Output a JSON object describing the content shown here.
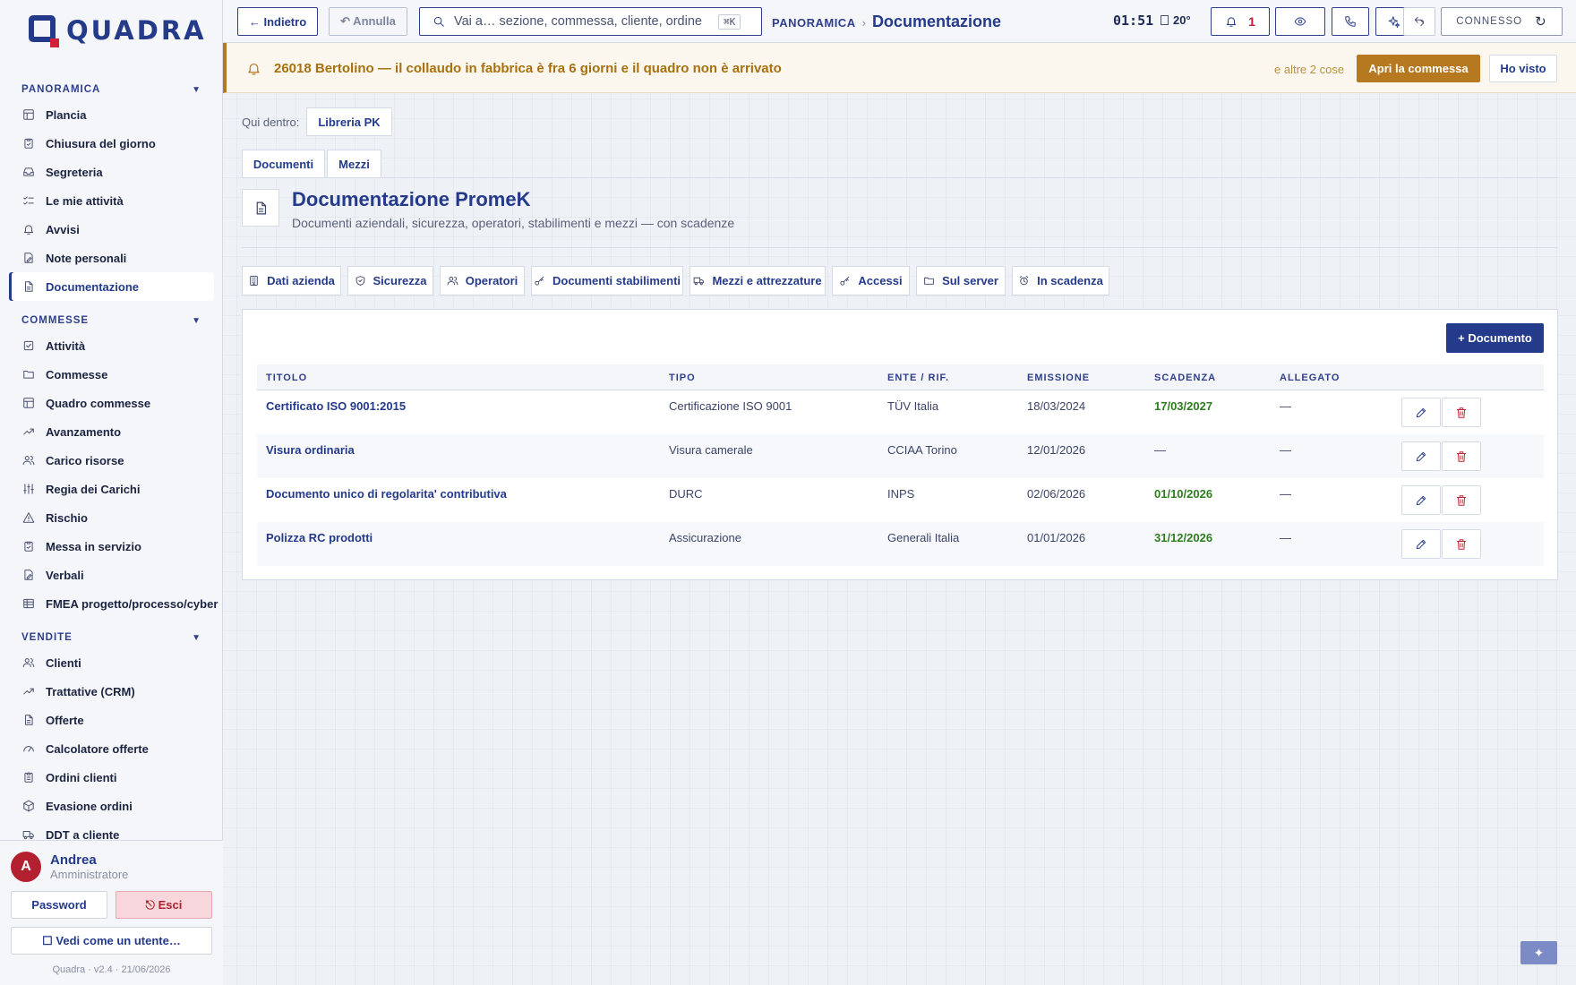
{
  "brand": {
    "name": "QUADRA"
  },
  "sidebar": {
    "groups": [
      {
        "title": "PANORAMICA",
        "items": [
          {
            "label": "Plancia",
            "icon": "layout-icon"
          },
          {
            "label": "Chiusura del giorno",
            "icon": "clipboard-check-icon"
          },
          {
            "label": "Segreteria",
            "icon": "inbox-icon"
          },
          {
            "label": "Le mie attività",
            "icon": "list-check-icon"
          },
          {
            "label": "Avvisi",
            "icon": "bell-icon"
          },
          {
            "label": "Note personali",
            "icon": "note-icon"
          },
          {
            "label": "Documentazione",
            "icon": "document-icon",
            "active": true
          }
        ]
      },
      {
        "title": "COMMESSE",
        "items": [
          {
            "label": "Attività",
            "icon": "checkbox-icon"
          },
          {
            "label": "Commesse",
            "icon": "folder-icon"
          },
          {
            "label": "Quadro commesse",
            "icon": "layout-icon"
          },
          {
            "label": "Avanzamento",
            "icon": "trend-icon"
          },
          {
            "label": "Carico risorse",
            "icon": "users-icon"
          },
          {
            "label": "Regia dei Carichi",
            "icon": "sliders-icon"
          },
          {
            "label": "Rischio",
            "icon": "warning-icon"
          },
          {
            "label": "Messa in servizio",
            "icon": "clipboard-check-icon"
          },
          {
            "label": "Verbali",
            "icon": "note-icon"
          },
          {
            "label": "FMEA progetto/processo/cyber",
            "icon": "table-icon"
          }
        ]
      },
      {
        "title": "VENDITE",
        "items": [
          {
            "label": "Clienti",
            "icon": "users-icon"
          },
          {
            "label": "Trattative (CRM)",
            "icon": "trend-icon"
          },
          {
            "label": "Offerte",
            "icon": "document-icon"
          },
          {
            "label": "Calcolatore offerte",
            "icon": "gauge-icon"
          },
          {
            "label": "Ordini clienti",
            "icon": "clipboard-icon"
          },
          {
            "label": "Evasione ordini",
            "icon": "package-icon"
          },
          {
            "label": "DDT a cliente",
            "icon": "truck-icon"
          }
        ]
      }
    ]
  },
  "user": {
    "initial": "A",
    "name": "Andrea",
    "role": "Amministratore",
    "password_label": "Password",
    "exit_label": "⎋ Esci",
    "impersonate_label": "☐ Vedi come un utente…",
    "version": "Quadra · v2.4 · 21/06/2026"
  },
  "topbar": {
    "back_label": "← Indietro",
    "undo_label": "↶ Annulla",
    "search_placeholder": "Vai a… sezione, commessa, cliente, ordine",
    "search_shortcut": "⌘K",
    "breadcrumb_parent": "PANORAMICA",
    "breadcrumb_sep": "›",
    "breadcrumb_current": "Documentazione",
    "clock": "01:51",
    "temperature": "20°",
    "notification_count": "1",
    "connection_label": "CONNESSO",
    "reload_glyph": "↻"
  },
  "alert": {
    "text": "26018 Bertolino — il collaudo in fabbrica è fra 6 giorni e il quadro non è arrivato",
    "more": "e altre 2 cose",
    "primary_label": "Apri la commessa",
    "secondary_label": "Ho visto",
    "color": "#b7791f"
  },
  "context": {
    "inside_label": "Qui dentro:",
    "inside_value": "Libreria PK",
    "subtabs": [
      "Documenti",
      "Mezzi"
    ]
  },
  "page": {
    "title": "Documentazione PromeK",
    "subtitle": "Documenti aziendali, sicurezza, operatori, stabilimenti e mezzi — con scadenze"
  },
  "categories": [
    {
      "label": "Dati azienda",
      "icon": "building-icon"
    },
    {
      "label": "Sicurezza",
      "icon": "shield-icon"
    },
    {
      "label": "Operatori",
      "icon": "users-icon"
    },
    {
      "label": "Documenti stabilimenti",
      "icon": "key-icon"
    },
    {
      "label": "Mezzi e attrezzature",
      "icon": "truck-icon"
    },
    {
      "label": "Accessi",
      "icon": "key-icon"
    },
    {
      "label": "Sul server",
      "icon": "folder-icon"
    },
    {
      "label": "In scadenza",
      "icon": "alarm-icon"
    }
  ],
  "table": {
    "add_label": "+ Documento",
    "columns": [
      "TITOLO",
      "TIPO",
      "ENTE / RIF.",
      "EMISSIONE",
      "SCADENZA",
      "ALLEGATO"
    ],
    "rows": [
      {
        "title": "Certificato ISO 9001:2015",
        "type": "Certificazione ISO 9001",
        "issuer": "TÜV Italia",
        "issued": "18/03/2024",
        "due": "17/03/2027",
        "attachment": "—"
      },
      {
        "title": "Visura ordinaria",
        "type": "Visura camerale",
        "issuer": "CCIAA Torino",
        "issued": "12/01/2026",
        "due": "—",
        "attachment": "—"
      },
      {
        "title": "Documento unico di regolarita' contributiva",
        "type": "DURC",
        "issuer": "INPS",
        "issued": "02/06/2026",
        "due": "01/10/2026",
        "attachment": "—"
      },
      {
        "title": "Polizza RC prodotti",
        "type": "Assicurazione",
        "issuer": "Generali Italia",
        "issued": "01/01/2026",
        "due": "31/12/2026",
        "attachment": "—"
      }
    ]
  },
  "fab": {
    "glyph": "✦"
  },
  "colors": {
    "accent": "#243a8a",
    "danger": "#c0202f",
    "ok": "#2e7d1e",
    "warn": "#b7791f"
  }
}
